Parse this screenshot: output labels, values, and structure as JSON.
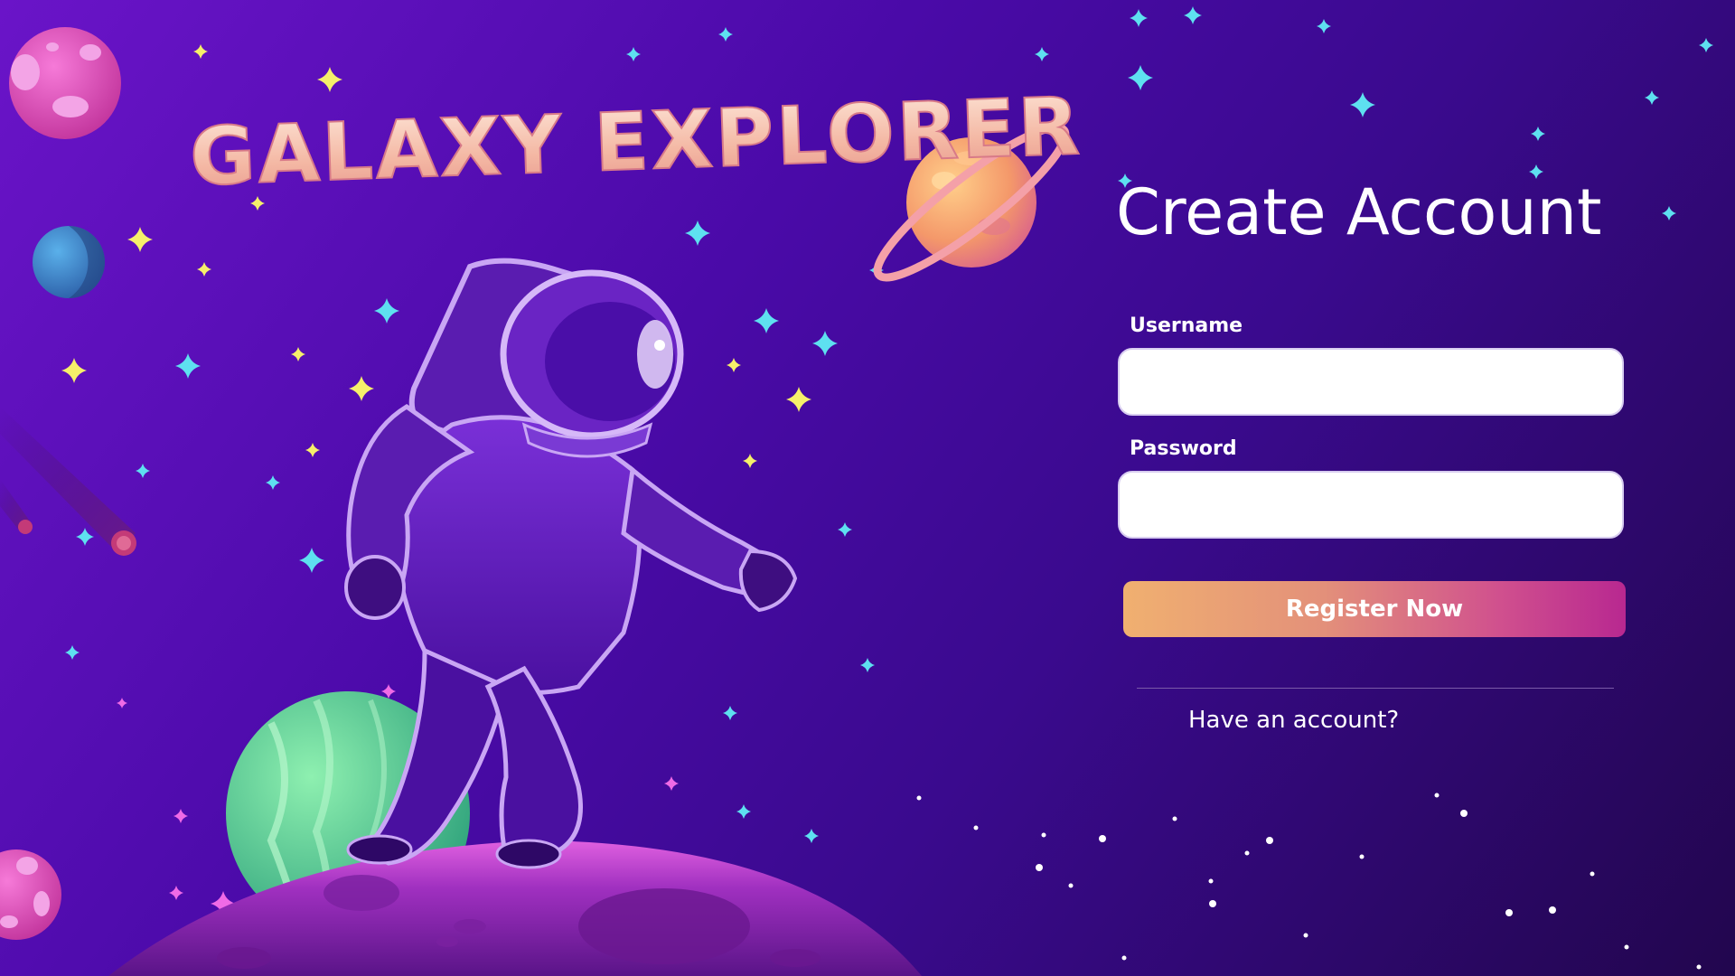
{
  "hero": {
    "logo_text": "GALAXY EXPLORER"
  },
  "form": {
    "title": "Create Account",
    "username": {
      "label": "Username",
      "value": "",
      "placeholder": ""
    },
    "password": {
      "label": "Password",
      "value": "",
      "placeholder": ""
    },
    "register_label": "Register Now",
    "have_account_label": "Have an account?"
  },
  "colors": {
    "background_left": "#6a14c8",
    "background_right": "#22064e",
    "button_gradient_start": "#f0b070",
    "button_gradient_end": "#b82890",
    "input_background": "#ffffff",
    "text": "#ffffff"
  },
  "icons": {
    "decor": [
      "astronaut-illustration",
      "ringed-planet-icon",
      "pink-planet-icon",
      "blue-planet-icon",
      "green-planet-icon",
      "moon-surface",
      "comet-icon",
      "star-icon"
    ]
  }
}
